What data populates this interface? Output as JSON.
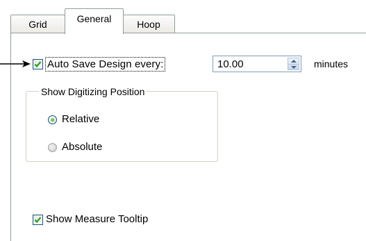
{
  "tabs": [
    {
      "label": "Grid",
      "selected": false
    },
    {
      "label": "General",
      "selected": true
    },
    {
      "label": "Hoop",
      "selected": false
    }
  ],
  "auto_save": {
    "checked": true,
    "label": "Auto Save Design every:",
    "interval_value": "10.00",
    "unit_label": "minutes"
  },
  "digitizing_position": {
    "group_title": "Show Digitizing Position",
    "options": [
      {
        "label": "Relative",
        "selected": true
      },
      {
        "label": "Absolute",
        "selected": false
      }
    ]
  },
  "measure_tooltip": {
    "checked": true,
    "label": "Show Measure Tooltip"
  },
  "colors": {
    "checkmark": "#21a121",
    "border": "#919b9c",
    "radio_selected": "#21a121"
  },
  "icons": {
    "pointer_arrow": "arrow-right-icon",
    "checkmark": "checkmark-icon",
    "spin_up": "spin-up-icon",
    "spin_down": "spin-down-icon"
  }
}
